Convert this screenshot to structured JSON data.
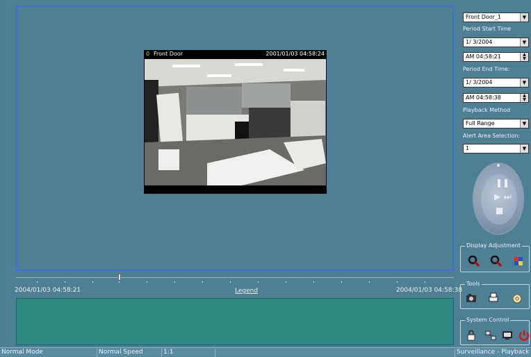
{
  "camera": {
    "channel": "0",
    "name": "Front Door",
    "timestamp": "2001/01/03 04:58:24"
  },
  "timeline": {
    "start": "2004/01/03 04:58:21",
    "end": "2004/01/03 04:58:38",
    "legend": "Legend"
  },
  "panel": {
    "camera_select": "Front Door_1",
    "period_start_label": "Period Start Time",
    "start_date": "1/ 3/2004",
    "start_time": "AM 04:58:21",
    "period_end_label": "Period End Time:",
    "end_date": "1/ 3/2004",
    "end_time": "AM 04:58:38",
    "playback_label": "Playback Method",
    "playback_value": "Full Range",
    "alert_label": "Alert Area Selection:",
    "alert_value": "1",
    "display_adjustment": "Display Adjustment",
    "tools": "Tools",
    "system_control": "System Control"
  },
  "status": {
    "mode": "Normal Mode",
    "speed": "Normal Speed",
    "ratio": "1:1",
    "app": "Surveillance - Playback"
  },
  "colors": {
    "background": "#4f7f94",
    "alert_area": "#2f8983",
    "viewer_border": "#3f6fd0"
  },
  "icons": [
    "zoom-in-icon",
    "zoom-out-icon",
    "color-adjust-icon",
    "snapshot-icon",
    "print-icon",
    "disk-icon",
    "lock-icon",
    "network-icon",
    "monitor-icon",
    "power-icon",
    "pause-icon",
    "play-icon",
    "next-icon",
    "stop-icon"
  ]
}
